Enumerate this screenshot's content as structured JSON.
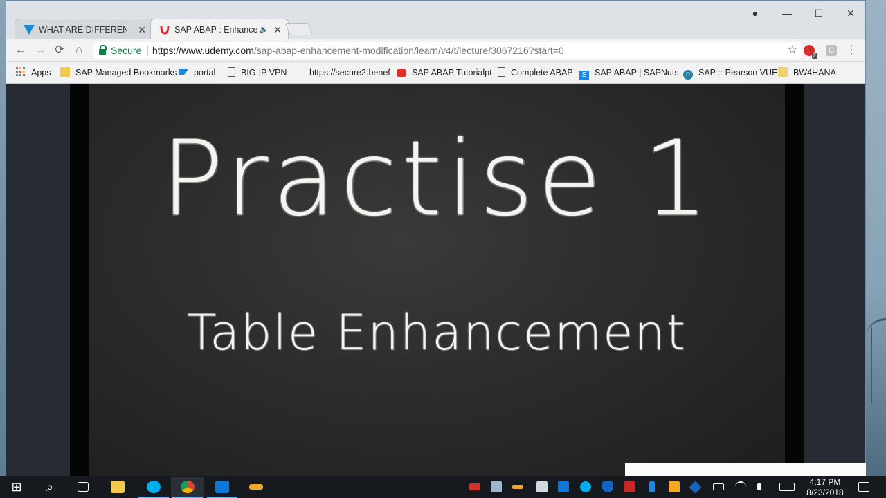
{
  "browser": {
    "tabs": [
      {
        "label": "WHAT ARE DIFFERENT M",
        "active": false,
        "favicon_color": "#1a8ad1"
      },
      {
        "label": "SAP ABAP : Enhancem",
        "active": true,
        "favicon_color": "#e0293d",
        "audio": "🔈"
      }
    ],
    "close_glyph": "✕",
    "window_controls": {
      "profile": "●",
      "minimize": "—",
      "maximize": "☐",
      "close": "✕"
    },
    "nav": {
      "back": "←",
      "forward": "→",
      "reload": "⟳",
      "home": "⌂"
    },
    "omnibox": {
      "secure_label": "Secure",
      "url_host": "https://www.udemy.com",
      "url_path": "/sap-abap-enhancement-modification/learn/v4/t/lecture/3067216?start=0"
    },
    "star": "☆",
    "menu": "⋮",
    "extensions": [
      {
        "name": "adblock-extension-icon",
        "badge": "2",
        "color": "#d32f2f"
      },
      {
        "name": "grammar-extension-icon",
        "badge": "G",
        "color": "#bdbdbd"
      }
    ],
    "bookmarks": [
      {
        "label": "Apps",
        "icon": "apps-grid-icon",
        "color": "#e8453c"
      },
      {
        "label": "SAP Managed Bookmarks",
        "icon": "folder-icon",
        "color": "#f2c94c"
      },
      {
        "label": "portal",
        "icon": "sap-logo-icon",
        "color": "#1a8ad1"
      },
      {
        "label": "BIG-IP VPN",
        "icon": "page-icon",
        "color": "#555555"
      },
      {
        "label": "https://secure2.benef",
        "icon": "blank-icon",
        "color": "#f2f2f2"
      },
      {
        "label": "SAP ABAP Tutorialpt",
        "icon": "youtube-icon",
        "color": "#e52d27"
      },
      {
        "label": "Complete ABAP",
        "icon": "page-icon",
        "color": "#555555"
      },
      {
        "label": "SAP ABAP | SAPNuts",
        "icon": "sapnuts-icon",
        "color": "#1e88e5"
      },
      {
        "label": "SAP :: Pearson VUE",
        "icon": "pearson-icon",
        "color": "#1f7fa6"
      },
      {
        "label": "BW4HANA",
        "icon": "folder-icon",
        "color": "#f2d36b"
      }
    ]
  },
  "video": {
    "title": "Practise 1",
    "subtitle": "Table Enhancement"
  },
  "taskbar": {
    "time": "4:17 PM",
    "date": "8/23/2018",
    "start": "⊞",
    "search": "⌕",
    "apps": [
      {
        "name": "task-view-icon",
        "color": "#ffffff"
      },
      {
        "name": "file-explorer-icon",
        "color": "#f2c94c"
      },
      {
        "name": "skype-icon",
        "color": "#00aff0"
      },
      {
        "name": "chrome-icon",
        "color": "#4caf50"
      },
      {
        "name": "outlook-icon",
        "color": "#0f78d4"
      },
      {
        "name": "sap-logon-icon",
        "color": "#f0a92e"
      }
    ]
  }
}
